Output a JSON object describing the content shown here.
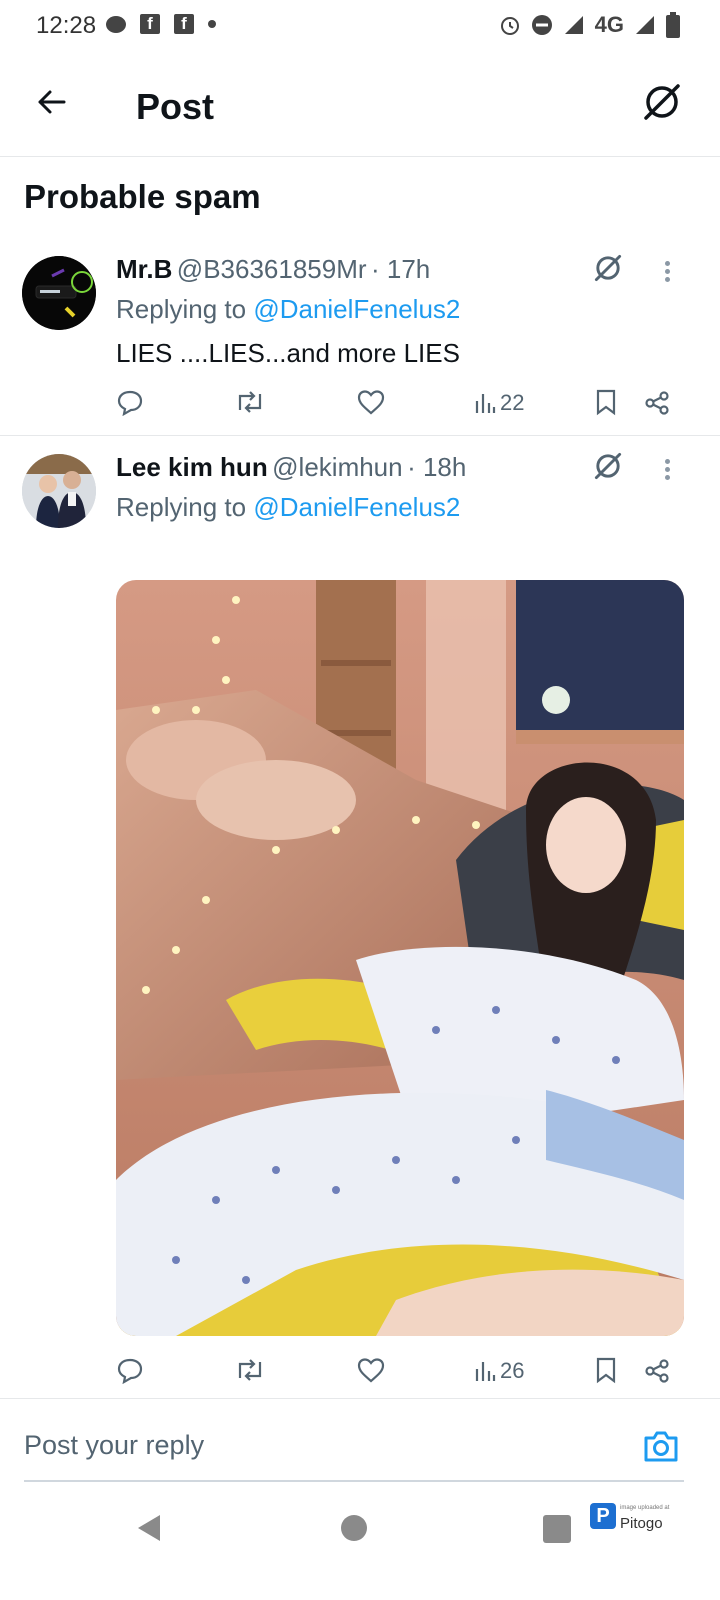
{
  "status_bar": {
    "time": "12:28",
    "network": "4G",
    "left_icons": [
      "chat-bubble-icon",
      "facebook-icon",
      "facebook-icon",
      "dot-icon"
    ],
    "right_icons": [
      "alarm-icon",
      "do-not-disturb-icon",
      "signal-icon",
      "data-arrows-icon",
      "battery-icon"
    ]
  },
  "header": {
    "title": "Post",
    "back_icon": "back-arrow-icon",
    "grok_icon": "grok-icon"
  },
  "section": {
    "title": "Probable spam"
  },
  "tweets": [
    {
      "name": "Mr.B",
      "handle": "@B36361859Mr",
      "time": "· 17h",
      "replying_prefix": "Replying to",
      "replying_to": "@DanielFenelus2",
      "text": "LIES ....LIES...and more LIES",
      "views": "22"
    },
    {
      "name": "Lee kim hun",
      "handle": "@lekimhun",
      "time": "· 18h",
      "replying_prefix": "Replying to",
      "replying_to": "@DanielFenelus2",
      "text": "",
      "views": "26",
      "media": "photo of a woman sleeping in a gaming chair in a bedroom with fairy lights"
    }
  ],
  "reply_bar": {
    "placeholder": "Post your reply",
    "icon": "camera-icon"
  },
  "nav_bar": {
    "icons": [
      "back-triangle-icon",
      "home-circle-icon",
      "recents-square-icon"
    ]
  },
  "watermark": {
    "small_text": "image uploaded at",
    "brand": "Pitogo",
    "brand_initial": "P"
  },
  "colors": {
    "accent": "#1d9bf0",
    "text_primary": "#0f1419",
    "text_secondary": "#536471"
  }
}
